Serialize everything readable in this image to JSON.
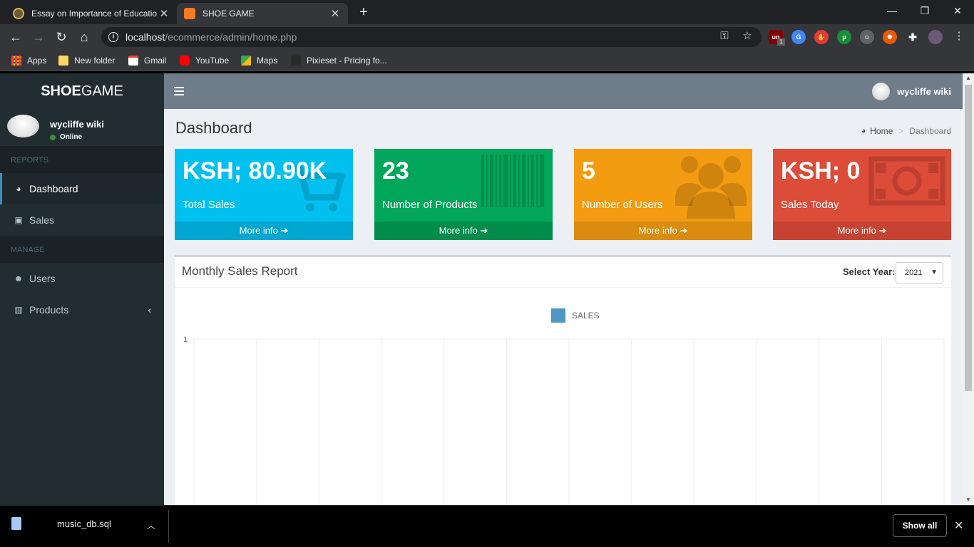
{
  "browser": {
    "tabs": [
      {
        "title": "Essay on Importance of Educatio",
        "close": "✕"
      },
      {
        "title": "SHOE GAME",
        "close": "✕"
      }
    ],
    "new_tab": "+",
    "window_controls": {
      "minimize": "—",
      "maximize": "❐",
      "close": "✕"
    },
    "url_host": "localhost",
    "url_path": "/ecommerce/admin/home.php",
    "nav": {
      "back": "←",
      "forward": "→",
      "reload": "↻",
      "home": "⌂"
    },
    "bookmarks": [
      {
        "label": "Apps",
        "icon": "apps-grid-icon"
      },
      {
        "label": "New folder",
        "icon": "folder-icon"
      },
      {
        "label": "Gmail",
        "icon": "gmail-icon"
      },
      {
        "label": "YouTube",
        "icon": "youtube-icon"
      },
      {
        "label": "Maps",
        "icon": "maps-icon"
      },
      {
        "label": "Pixieset - Pricing fo...",
        "icon": "pixieset-icon"
      }
    ],
    "extensions_badge": "1"
  },
  "sidebar": {
    "logo_bold": "SHOE",
    "logo_rest": "GAME",
    "user": {
      "name": "wycliffe wiki",
      "status": "Online"
    },
    "sections": [
      {
        "title": "REPORTS",
        "items": [
          {
            "label": "Dashboard",
            "icon": "dashboard-icon",
            "active": true
          },
          {
            "label": "Sales",
            "icon": "money-icon",
            "active": false
          }
        ]
      },
      {
        "title": "MANAGE",
        "items": [
          {
            "label": "Users",
            "icon": "users-icon",
            "active": false
          },
          {
            "label": "Products",
            "icon": "barcode-icon",
            "active": false,
            "chevron": "‹"
          }
        ]
      }
    ]
  },
  "header": {
    "user": "wycliffe wiki"
  },
  "content": {
    "title": "Dashboard",
    "breadcrumb": {
      "home": "Home",
      "current": "Dashboard",
      "separator": ">"
    }
  },
  "stats": [
    {
      "value": "KSH; 80.90K",
      "label": "Total Sales",
      "more": "More info",
      "color": "#00c0ef",
      "footer_color": "#00a7d0",
      "icon": "shopping-cart-icon"
    },
    {
      "value": "23",
      "label": "Number of Products",
      "more": "More info",
      "color": "#00a65a",
      "footer_color": "#008d4c",
      "icon": "barcode-icon"
    },
    {
      "value": "5",
      "label": "Number of Users",
      "more": "More info",
      "color": "#f39c12",
      "footer_color": "#da8c10",
      "icon": "users-icon"
    },
    {
      "value": "KSH; 0",
      "label": "Sales Today",
      "more": "More info",
      "color": "#dd4b39",
      "footer_color": "#c64333",
      "icon": "money-icon"
    }
  ],
  "report": {
    "title": "Monthly Sales Report",
    "select_label": "Select Year:",
    "selected_year": "2021"
  },
  "chart_data": {
    "type": "bar",
    "series": [
      {
        "name": "SALES",
        "color": "#3c8dbc",
        "values": [
          0,
          0,
          0,
          0,
          0,
          0,
          0,
          0,
          0,
          0,
          0,
          0
        ]
      }
    ],
    "y_tick_labels": [
      "1"
    ],
    "grid": true,
    "legend": "top"
  },
  "downloads": {
    "file": "music_db.sql",
    "show_all": "Show all",
    "close": "✕"
  }
}
